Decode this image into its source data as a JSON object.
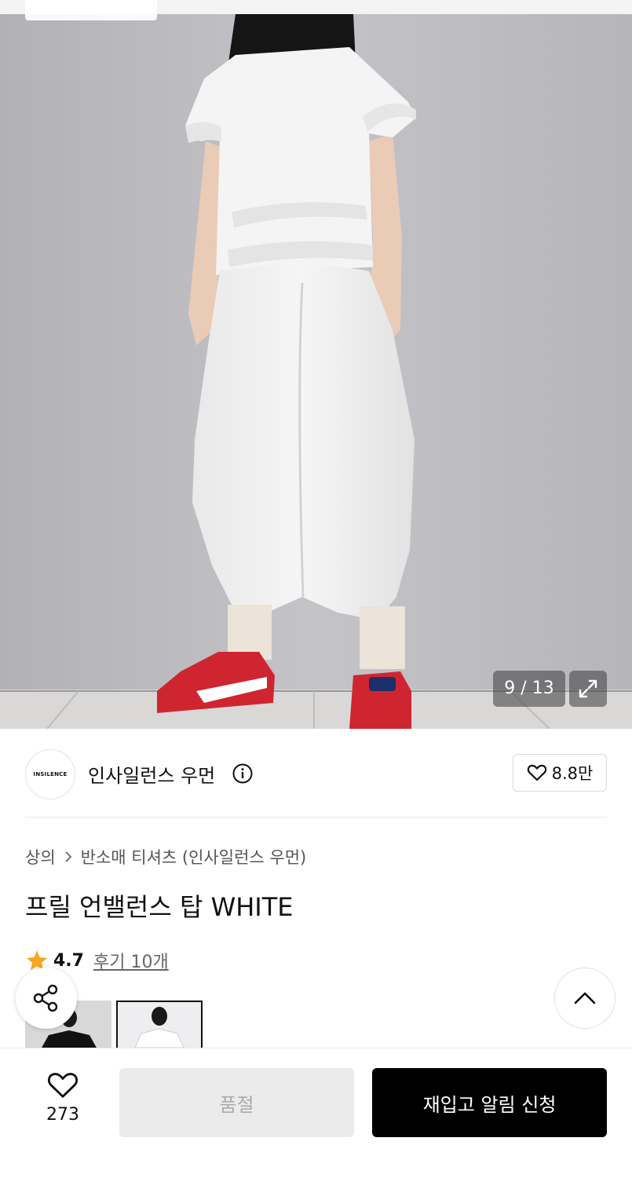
{
  "gallery": {
    "image_alt": "model wearing white frill top and white skirt with red sneakers",
    "counter": "9 / 13",
    "expand_icon": "expand-icon"
  },
  "brand": {
    "logo_text": "INSILENCE",
    "name": "인사일런스 우먼",
    "info_icon": "info-icon",
    "like_count": "8.8만",
    "like_icon": "heart-outline-icon"
  },
  "breadcrumb": {
    "category": "상의",
    "subcategory": "반소매 티셔츠 (인사일런스 우먼)"
  },
  "product": {
    "title": "프릴 언밸런스 탑 WHITE",
    "rating": "4.7",
    "review_link": "후기 10개"
  },
  "floating": {
    "share_icon": "share-icon",
    "scroll_top_icon": "chevron-up-icon"
  },
  "bottom_bar": {
    "wish_count": "273",
    "soldout_label": "품절",
    "restock_label": "재입고 알림 신청"
  },
  "colors": {
    "accent_star": "#F5A623",
    "primary_button": "#000000",
    "disabled_button": "#EBEBEB"
  }
}
